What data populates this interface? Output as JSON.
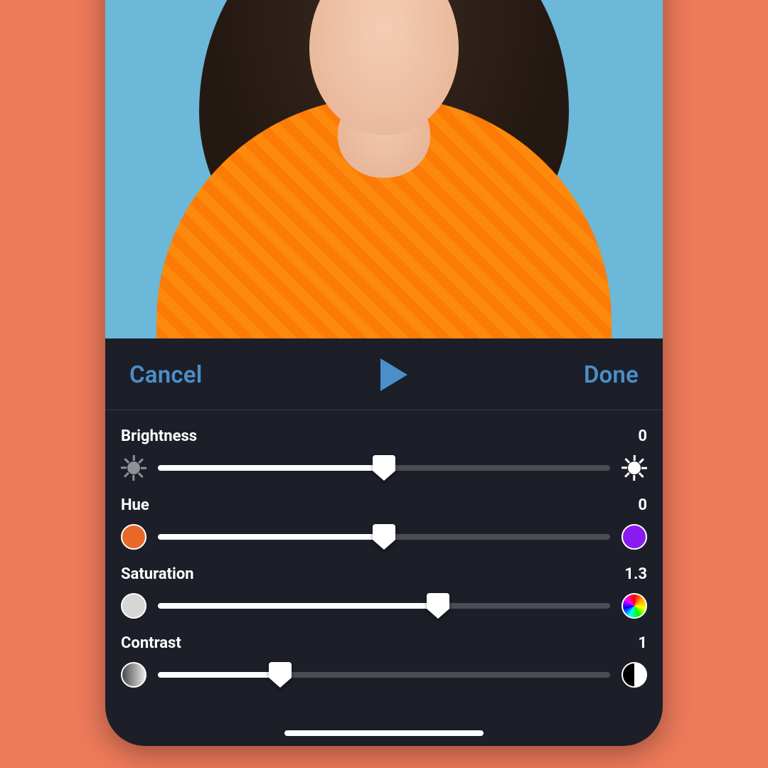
{
  "toolbar": {
    "cancel_label": "Cancel",
    "done_label": "Done",
    "play_icon": "play-icon"
  },
  "sliders": [
    {
      "key": "brightness",
      "label": "Brightness",
      "value_text": "0",
      "fill_pct": 50,
      "thumb_pct": 50,
      "left_icon": "sun-dim-icon",
      "right_icon": "sun-bright-icon"
    },
    {
      "key": "hue",
      "label": "Hue",
      "value_text": "0",
      "fill_pct": 50,
      "thumb_pct": 50,
      "left_icon": "hue-orange-icon",
      "right_icon": "hue-purple-icon"
    },
    {
      "key": "saturation",
      "label": "Saturation",
      "value_text": "1.3",
      "fill_pct": 62,
      "thumb_pct": 62,
      "left_icon": "grey-circle-icon",
      "right_icon": "rainbow-icon"
    },
    {
      "key": "contrast",
      "label": "Contrast",
      "value_text": "1",
      "fill_pct": 27,
      "thumb_pct": 27,
      "left_icon": "grey-grad-icon",
      "right_icon": "half-circle-icon"
    }
  ],
  "colors": {
    "accent": "#4a8fca",
    "panel": "#1c1e28",
    "background": "#ed7a5a"
  }
}
